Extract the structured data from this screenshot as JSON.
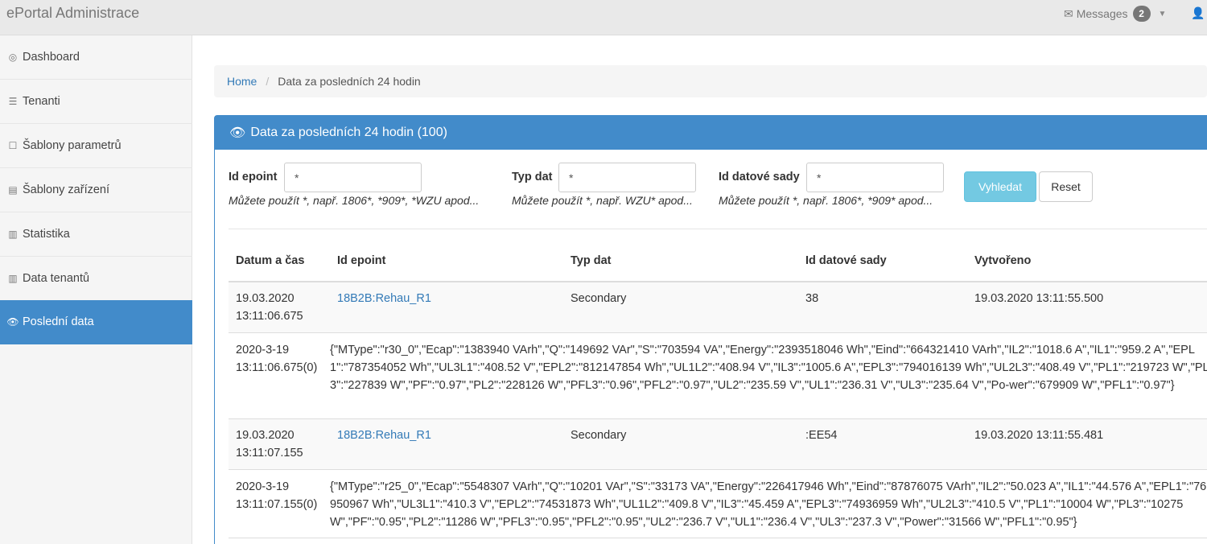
{
  "topbar": {
    "brand": "ePortal Administrace",
    "messages_label": "Messages",
    "messages_count": "2"
  },
  "sidebar": {
    "items": [
      {
        "label": "Dashboard",
        "icon": "dashboard-icon"
      },
      {
        "label": "Tenanti",
        "icon": "list-icon"
      },
      {
        "label": "Šablony parametrů",
        "icon": "square-icon"
      },
      {
        "label": "Šablony zařízení",
        "icon": "device-icon"
      },
      {
        "label": "Statistika",
        "icon": "bar-chart-icon"
      },
      {
        "label": "Data tenantů",
        "icon": "bar-chart-icon"
      },
      {
        "label": "Poslední data",
        "icon": "eye-icon",
        "active": true
      }
    ]
  },
  "breadcrumb": {
    "home": "Home",
    "current": "Data za posledních 24 hodin"
  },
  "panel": {
    "title": "Data za posledních 24 hodin (100)"
  },
  "filters": {
    "epoint": {
      "label": "Id epoint",
      "value": "*",
      "hint": "Můžete použít *, např. 1806*, *909*, *WZU apod..."
    },
    "typ": {
      "label": "Typ dat",
      "value": "*",
      "hint": "Můžete použít *, např. WZU* apod..."
    },
    "sada": {
      "label": "Id datové sady",
      "value": "*",
      "hint": "Můžete použít *, např. 1806*, *909* apod..."
    },
    "search_label": "Vyhledat",
    "reset_label": "Reset"
  },
  "table": {
    "headers": [
      "Datum a čas",
      "Id epoint",
      "Typ dat",
      "Id datové sady",
      "Vytvořeno"
    ],
    "rows": [
      {
        "date1": "19.03.2020",
        "date2": "13:11:06.675",
        "epoint": "18B2B:Rehau_R1",
        "typ": "Secondary",
        "sada": "38",
        "vytvoreno": "19.03.2020 13:11:55.500",
        "json_date1": "2020-3-19",
        "json_date2": "13:11:06.675(0)",
        "json": "{\"MType\":\"r30_0\",\"Ecap\":\"1383940 VArh\",\"Q\":\"149692 VAr\",\"S\":\"703594 VA\",\"Energy\":\"2393518046 Wh\",\"Eind\":\"664321410 VArh\",\"IL2\":\"1018.6 A\",\"IL1\":\"959.2 A\",\"EPL1\":\"787354052 Wh\",\"UL3L1\":\"408.52 V\",\"EPL2\":\"812147854 Wh\",\"UL1L2\":\"408.94 V\",\"IL3\":\"1005.6 A\",\"EPL3\":\"794016139 Wh\",\"UL2L3\":\"408.49 V\",\"PL1\":\"219723 W\",\"PL3\":\"227839 W\",\"PF\":\"0.97\",\"PL2\":\"228126 W\",\"PFL3\":\"0.96\",\"PFL2\":\"0.97\",\"UL2\":\"235.59 V\",\"UL1\":\"236.31 V\",\"UL3\":\"235.64 V\",\"Po-wer\":\"679909 W\",\"PFL1\":\"0.97\"}"
      },
      {
        "date1": "19.03.2020",
        "date2": "13:11:07.155",
        "epoint": "18B2B:Rehau_R1",
        "typ": "Secondary",
        "sada": ":EE54",
        "vytvoreno": "19.03.2020 13:11:55.481",
        "json_date1": "2020-3-19",
        "json_date2": "13:11:07.155(0)",
        "json": "{\"MType\":\"r25_0\",\"Ecap\":\"5548307 VArh\",\"Q\":\"10201 VAr\",\"S\":\"33173 VA\",\"Energy\":\"226417946 Wh\",\"Eind\":\"87876075 VArh\",\"IL2\":\"50.023 A\",\"IL1\":\"44.576 A\",\"EPL1\":\"76950967 Wh\",\"UL3L1\":\"410.3 V\",\"EPL2\":\"74531873 Wh\",\"UL1L2\":\"409.8 V\",\"IL3\":\"45.459 A\",\"EPL3\":\"74936959 Wh\",\"UL2L3\":\"410.5 V\",\"PL1\":\"10004 W\",\"PL3\":\"10275 W\",\"PF\":\"0.95\",\"PL2\":\"11286 W\",\"PFL3\":\"0.95\",\"PFL2\":\"0.95\",\"UL2\":\"236.7 V\",\"UL1\":\"236.4 V\",\"UL3\":\"237.3 V\",\"Power\":\"31566 W\",\"PFL1\":\"0.95\"}"
      }
    ]
  }
}
